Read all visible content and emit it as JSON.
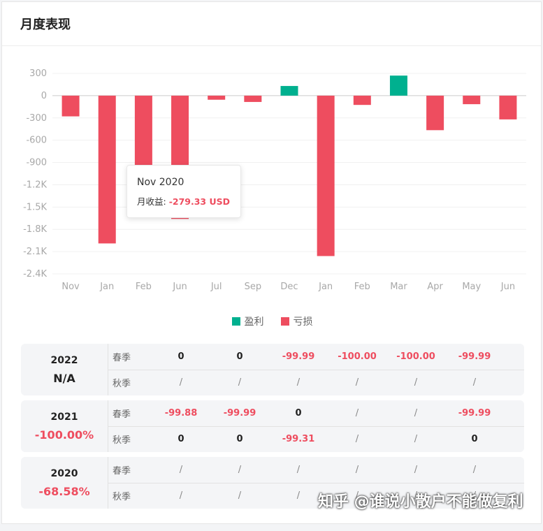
{
  "card": {
    "title": "月度表现"
  },
  "chart_data": {
    "type": "bar",
    "categories": [
      "Nov",
      "Jan",
      "Feb",
      "Jun",
      "Jul",
      "Sep",
      "Dec",
      "Jan",
      "Feb",
      "Mar",
      "Apr",
      "May",
      "Jun"
    ],
    "values": [
      -279.33,
      -1990,
      -1020,
      -1660,
      -55,
      -85,
      130,
      -2160,
      -125,
      270,
      -465,
      -115,
      -320
    ],
    "ylim": [
      -2400,
      300
    ],
    "yticks": [
      300,
      0,
      -300,
      -600,
      -900,
      -1200,
      -1500,
      -1800,
      -2100,
      -2400
    ],
    "ytick_labels": [
      "300",
      "0",
      "-300",
      "-600",
      "-900",
      "-1.2K",
      "-1.5K",
      "-1.8K",
      "-2.1K",
      "-2.4K"
    ],
    "colors": {
      "profit": "#00b08f",
      "loss": "#ee4d5f"
    },
    "legend": [
      {
        "name": "盈利",
        "color": "#00b08f"
      },
      {
        "name": "亏损",
        "color": "#ee4d5f"
      }
    ],
    "legend_position": "bottom-center",
    "grid": true,
    "tooltip": {
      "date": "Nov 2020",
      "label": "月收益: ",
      "value": "-279.33 USD"
    }
  },
  "summary": {
    "years": [
      {
        "year": "2022",
        "total": "N/A",
        "total_color": "#222222",
        "rows": [
          {
            "season": "春季",
            "cells": [
              "0",
              "0",
              "-99.99",
              "-100.00",
              "-100.00",
              "-99.99"
            ]
          },
          {
            "season": "秋季",
            "cells": [
              "/",
              "/",
              "/",
              "/",
              "/",
              "/"
            ]
          }
        ]
      },
      {
        "year": "2021",
        "total": "-100.00%",
        "total_color": "#ee4d5f",
        "rows": [
          {
            "season": "春季",
            "cells": [
              "-99.88",
              "-99.99",
              "0",
              "/",
              "/",
              "-99.99"
            ]
          },
          {
            "season": "秋季",
            "cells": [
              "0",
              "0",
              "-99.31",
              "/",
              "/",
              "0"
            ]
          }
        ]
      },
      {
        "year": "2020",
        "total": "-68.58%",
        "total_color": "#ee4d5f",
        "rows": [
          {
            "season": "春季",
            "cells": [
              "/",
              "/",
              "/",
              "/",
              "/",
              "/"
            ]
          },
          {
            "season": "秋季",
            "cells": [
              "/",
              "/",
              "/",
              "/",
              "/",
              "/"
            ]
          }
        ]
      }
    ]
  },
  "watermark": "知乎 @谁说小散户不能做复利"
}
